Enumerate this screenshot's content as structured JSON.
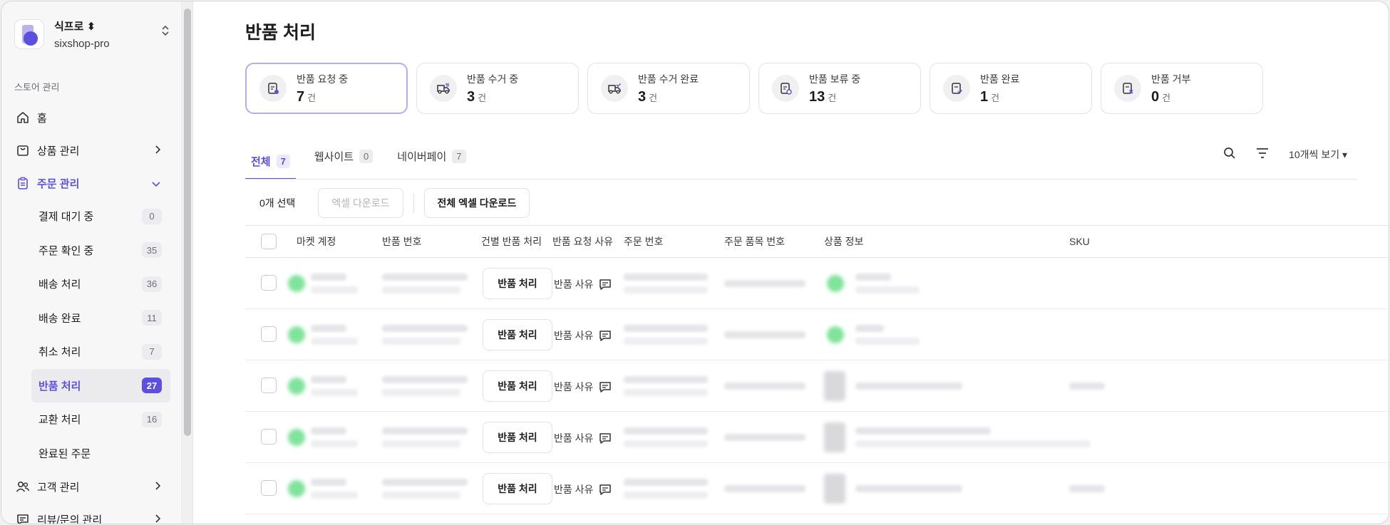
{
  "store": {
    "name": "식프로 ⬍",
    "id": "sixshop-pro"
  },
  "sidebar": {
    "section_label": "스토어 관리",
    "items": [
      {
        "label": "홈",
        "icon": "home-icon"
      },
      {
        "label": "상품 관리",
        "icon": "bag-icon",
        "arrow": "›"
      },
      {
        "label": "주문 관리",
        "icon": "clipboard-icon",
        "arrow": "⌄"
      }
    ],
    "sub_items": [
      {
        "label": "결제 대기 중",
        "count": "0"
      },
      {
        "label": "주문 확인 중",
        "count": "35"
      },
      {
        "label": "배송 처리",
        "count": "36"
      },
      {
        "label": "배송 완료",
        "count": "11"
      },
      {
        "label": "취소 처리",
        "count": "7"
      },
      {
        "label": "반품 처리",
        "count": "27"
      },
      {
        "label": "교환 처리",
        "count": "16"
      },
      {
        "label": "완료된 주문",
        "count": ""
      }
    ],
    "bottom_items": [
      {
        "label": "고객 관리",
        "icon": "users-icon",
        "arrow": "›"
      },
      {
        "label": "리뷰/문의 관리",
        "icon": "chat-icon",
        "arrow": "›"
      }
    ]
  },
  "page": {
    "title": "반품 처리"
  },
  "cards": [
    {
      "label": "반품 요청 중",
      "count": "7",
      "unit": "건"
    },
    {
      "label": "반품 수거 중",
      "count": "3",
      "unit": "건"
    },
    {
      "label": "반품 수거 완료",
      "count": "3",
      "unit": "건"
    },
    {
      "label": "반품 보류 중",
      "count": "13",
      "unit": "건"
    },
    {
      "label": "반품 완료",
      "count": "1",
      "unit": "건"
    },
    {
      "label": "반품 거부",
      "count": "0",
      "unit": "건"
    }
  ],
  "tabs": [
    {
      "label": "전체",
      "count": "7"
    },
    {
      "label": "웹사이트",
      "count": "0"
    },
    {
      "label": "네이버페이",
      "count": "7"
    }
  ],
  "tools": {
    "page_size": "10개씩 보기 ▾"
  },
  "actions": {
    "selected": "0개 선택",
    "excel": "엑셀 다운로드",
    "excel_all": "전체 엑셀 다운로드"
  },
  "columns": [
    "마켓 계정",
    "반품 번호",
    "건별 반품 처리",
    "반품 요청 사유",
    "주문 번호",
    "주문 품목 번호",
    "상품 정보",
    "SKU"
  ],
  "rows": [
    {
      "action": "반품 처리",
      "reason": "반품 사유"
    },
    {
      "action": "반품 처리",
      "reason": "반품 사유"
    },
    {
      "action": "반품 처리",
      "reason": "반품 사유"
    },
    {
      "action": "반품 처리",
      "reason": "반품 사유"
    },
    {
      "action": "반품 처리",
      "reason": "반품 사유"
    }
  ],
  "colors": {
    "accent": "#5b4fe0"
  }
}
